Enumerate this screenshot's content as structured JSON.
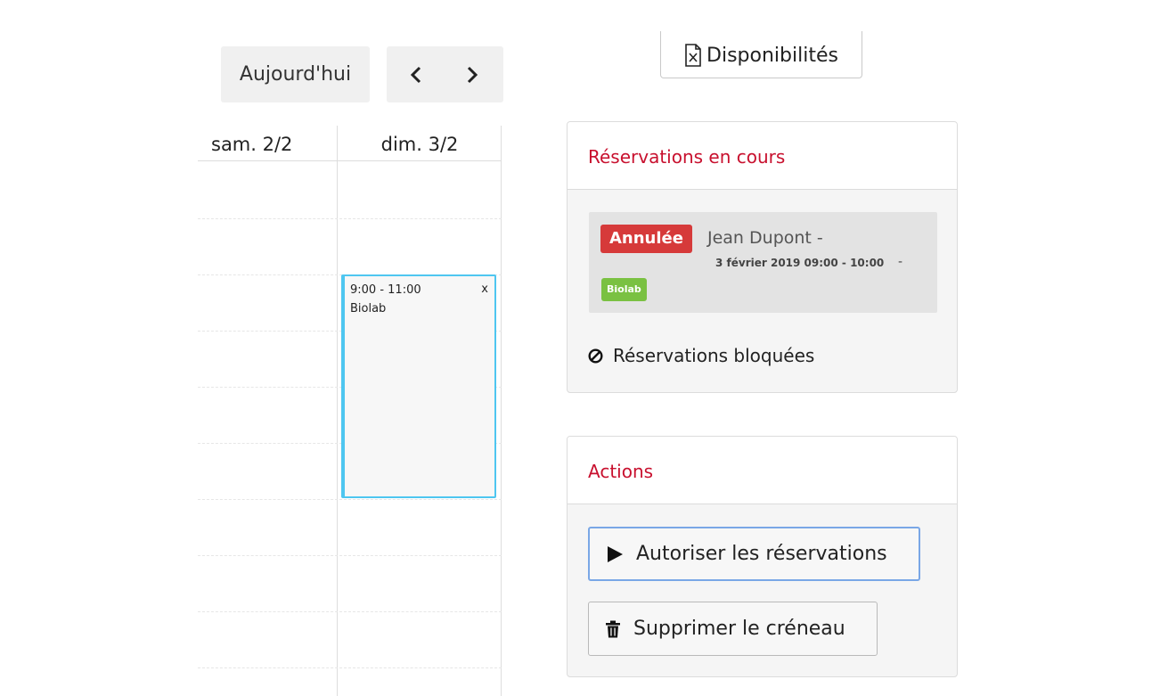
{
  "toolbar": {
    "today_label": "Aujourd'hui",
    "prev_icon": "chevron-left-icon",
    "next_icon": "chevron-right-icon",
    "dispo_label": "Disponibilités",
    "dispo_icon": "excel-file-icon"
  },
  "calendar": {
    "columns": [
      "sam. 2/2",
      "dim. 3/2"
    ],
    "event": {
      "time": "9:00 - 11:00",
      "title": "Biolab",
      "close": "x",
      "border_color": "#4ec6f0"
    }
  },
  "reservations_panel": {
    "title": "Réservations en cours",
    "item": {
      "status": "Annulée",
      "user": "Jean Dupont -",
      "datetime": "3 février 2019 09:00 - 10:00",
      "separator": "-",
      "resource": "Biolab"
    },
    "blocked_label": "Réservations bloquées",
    "blocked_icon": "ban-icon"
  },
  "actions_panel": {
    "title": "Actions",
    "allow_label": "Autoriser les réservations",
    "allow_icon": "play-icon",
    "delete_label": "Supprimer le créneau",
    "delete_icon": "trash-icon"
  },
  "colors": {
    "panel_title": "#c8102e",
    "badge_cancelled": "#d63a3a",
    "badge_resource": "#7ac142"
  }
}
